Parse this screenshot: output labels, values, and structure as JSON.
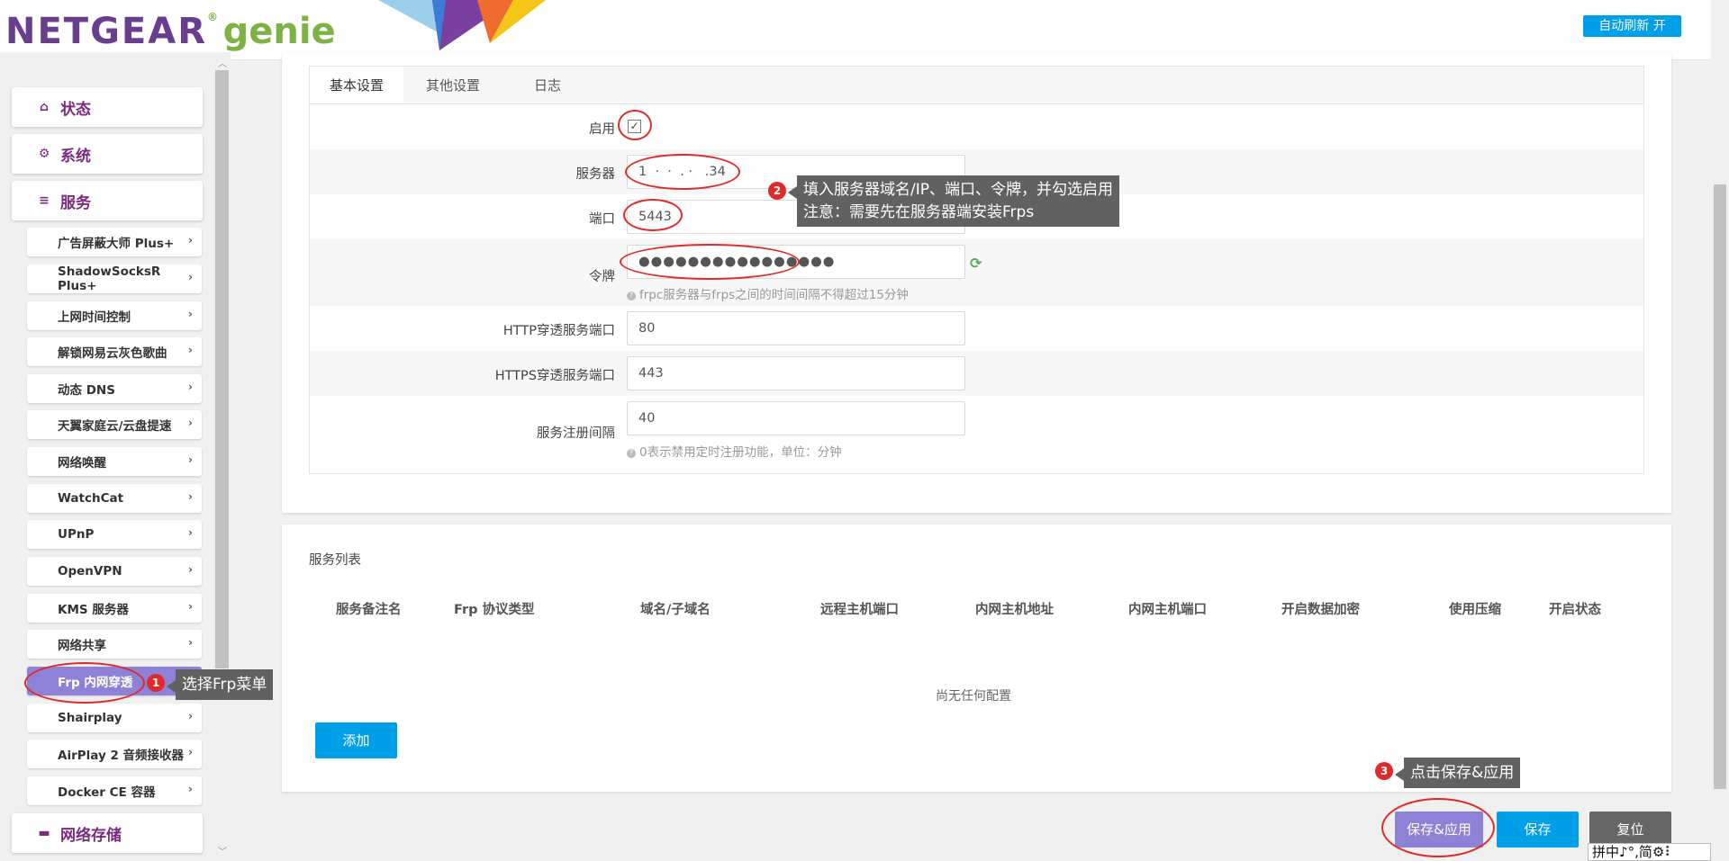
{
  "header": {
    "logo_netgear": "NETGEAR",
    "logo_genie": "genie",
    "logo_reg": "®",
    "auto_refresh": "自动刷新 开",
    "accent": "#00a0e9"
  },
  "sidebar": {
    "status": "状态",
    "system": "系统",
    "services": "服务",
    "network_storage": "网络存储",
    "sub_items": [
      "广告屏蔽大师 Plus+",
      "ShadowSocksR Plus+",
      "上网时间控制",
      "解锁网易云灰色歌曲",
      "动态 DNS",
      "天翼家庭云/云盘提速",
      "网络唤醒",
      "WatchCat",
      "UPnP",
      "OpenVPN",
      "KMS 服务器",
      "网络共享",
      "Frp 内网穿透",
      "Shairplay",
      "AirPlay 2 音频接收器",
      "Docker CE 容器"
    ],
    "active_index": 12,
    "active_color": "#8e82d8"
  },
  "tabs": [
    "基本设置",
    "其他设置",
    "日志"
  ],
  "form": {
    "enable_label": "启用",
    "enable_checked": "✓",
    "server_label": "服务器",
    "server_value": "1  ·  ·  . ·   .34",
    "port_label": "端口",
    "port_value": "5443",
    "token_label": "令牌",
    "token_value": "●●●●●●●●●●●●●●●●",
    "token_hint": "frpc服务器与frps之间的时间间隔不得超过15分钟",
    "http_label": "HTTP穿透服务端口",
    "http_value": "80",
    "https_label": "HTTPS穿透服务端口",
    "https_value": "443",
    "interval_label": "服务注册间隔",
    "interval_value": "40",
    "interval_hint": "0表示禁用定时注册功能，单位：分钟"
  },
  "service_list": {
    "title": "服务列表",
    "headers": [
      "服务备注名",
      "Frp 协议类型",
      "域名/子域名",
      "远程主机端口",
      "内网主机地址",
      "内网主机端口",
      "开启数据加密",
      "使用压缩",
      "开启状态"
    ],
    "empty_text": "尚无任何配置",
    "add_button": "添加"
  },
  "buttons": {
    "save_apply": "保存&应用",
    "save": "保存",
    "reset": "复位"
  },
  "annotations": {
    "step1_num": "1",
    "step1_text": "选择Frp菜单",
    "step2_num": "2",
    "step2_line1": "填入服务器域名/IP、端口、令牌，并勾选启用",
    "step2_line2": "注意：需要先在服务器端安装Frps",
    "step3_num": "3",
    "step3_text": "点击保存&应用",
    "ring_color": "#e02a2a"
  },
  "ime": "拼中♪°,简⚙⠇"
}
